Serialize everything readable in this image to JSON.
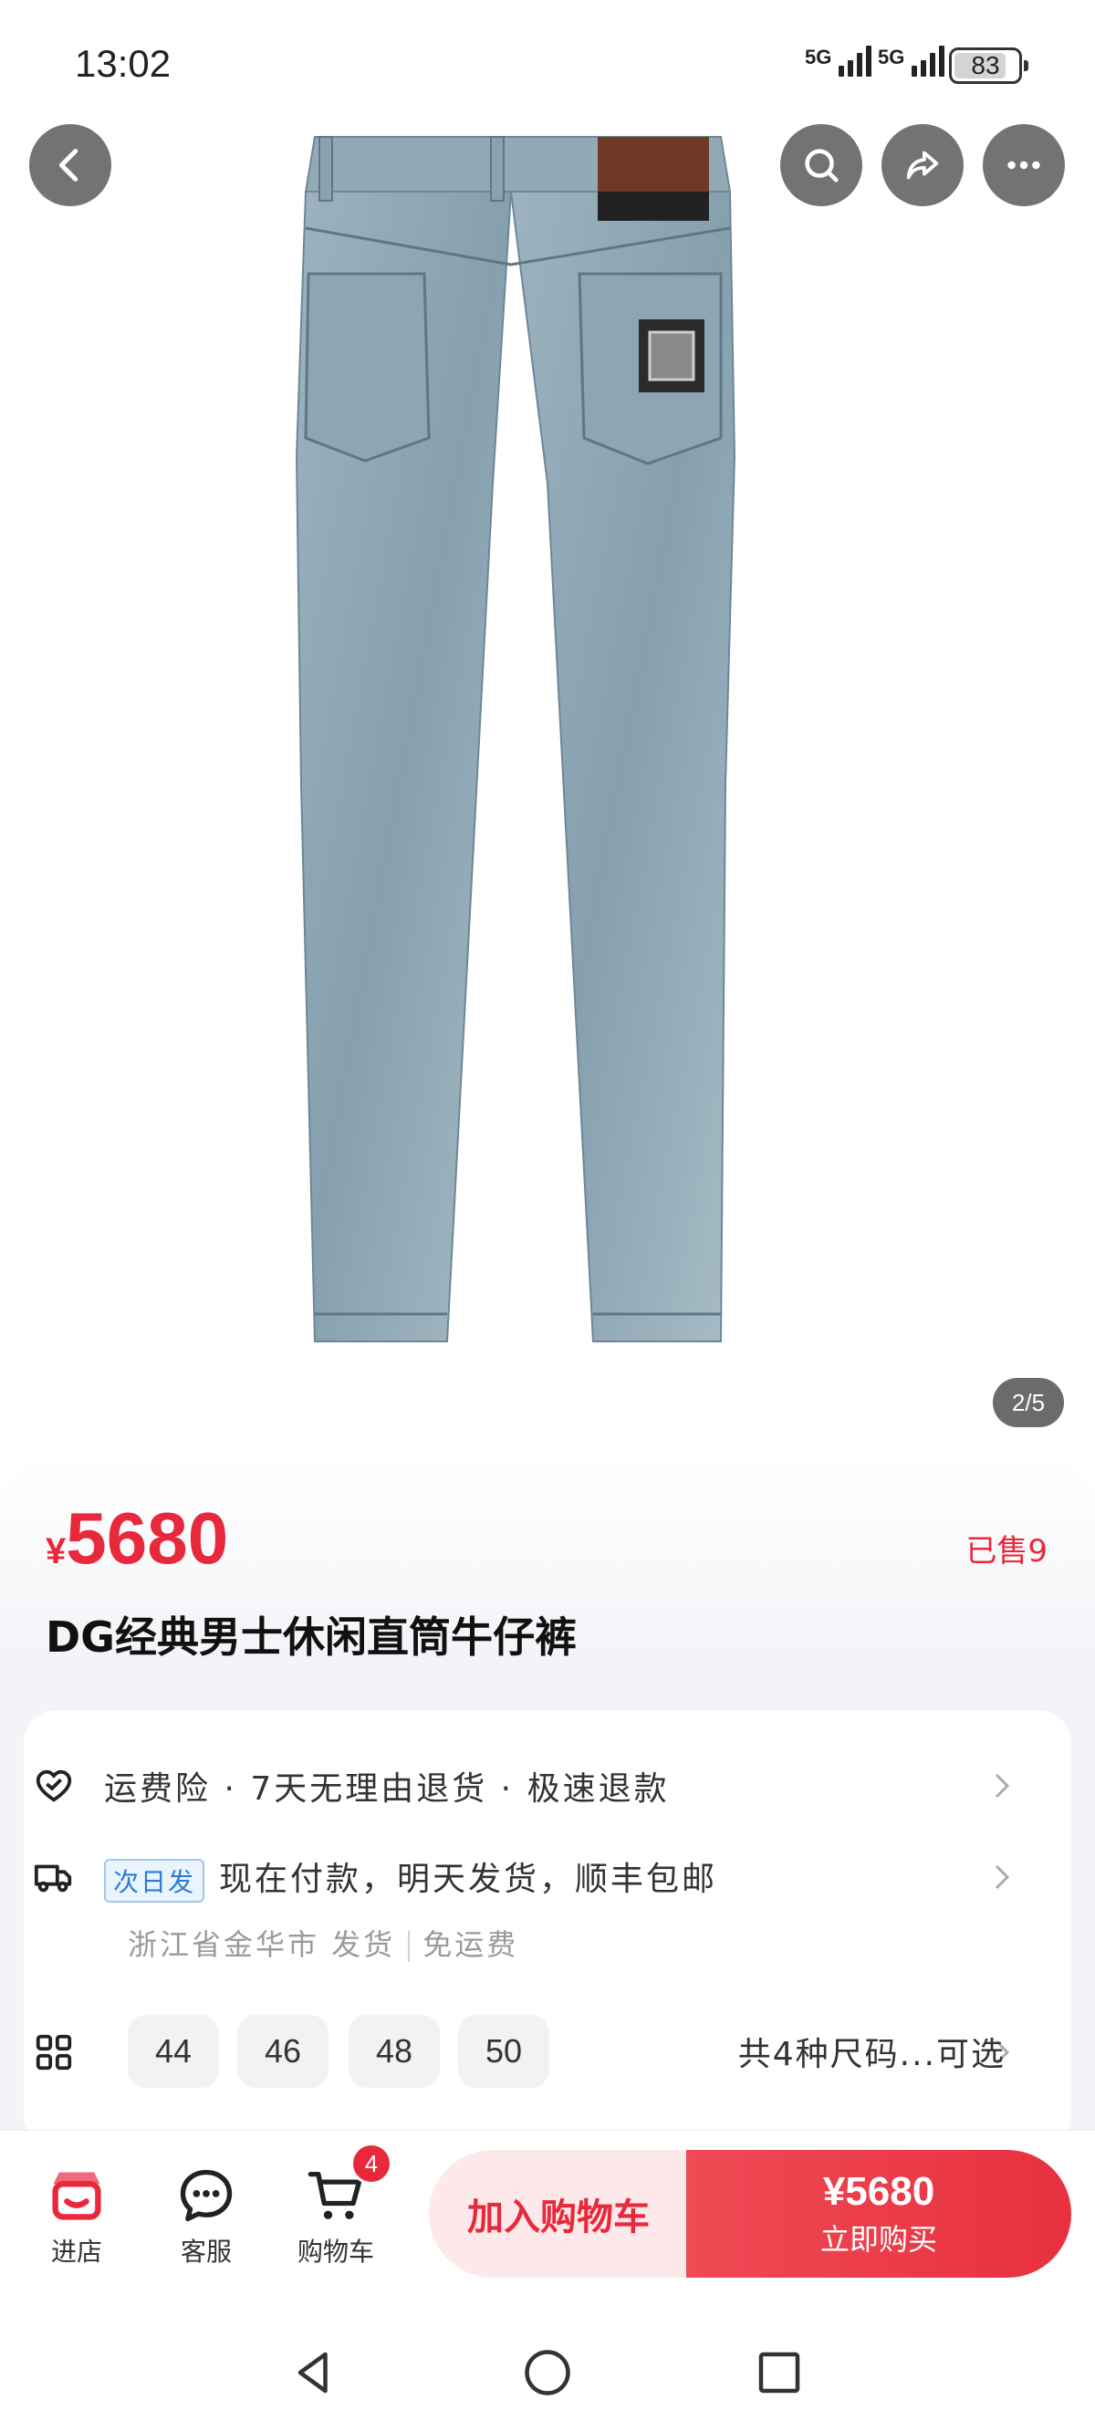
{
  "status_bar": {
    "time": "13:02",
    "signal_label": "5G",
    "battery": "83",
    "battery_level": 0.83
  },
  "gallery": {
    "page_indicator": "2/5"
  },
  "product": {
    "currency": "¥",
    "price": "5680",
    "sold": "已售9",
    "title": "DG经典男士休闲直筒牛仔裤"
  },
  "services": {
    "insurance": "运费险 · 7天无理由退货 · 极速退款",
    "shipping_tag": "次日发",
    "shipping_text": "现在付款，明天发货，顺丰包邮",
    "origin": "浙江省金华市 发货",
    "freight": "免运费"
  },
  "sizes": {
    "options": [
      "44",
      "46",
      "48",
      "50"
    ],
    "summary": "共4种尺码...可选"
  },
  "bottom_bar": {
    "store_label": "进店",
    "service_label": "客服",
    "cart_label": "购物车",
    "cart_count": "4",
    "add_to_cart": "加入购物车",
    "buy_price": "¥5680",
    "buy_now": "立即购买"
  },
  "colors": {
    "accent": "#e8283b",
    "tag_blue": "#2c7ad6",
    "denim": "#8fa8b6"
  }
}
